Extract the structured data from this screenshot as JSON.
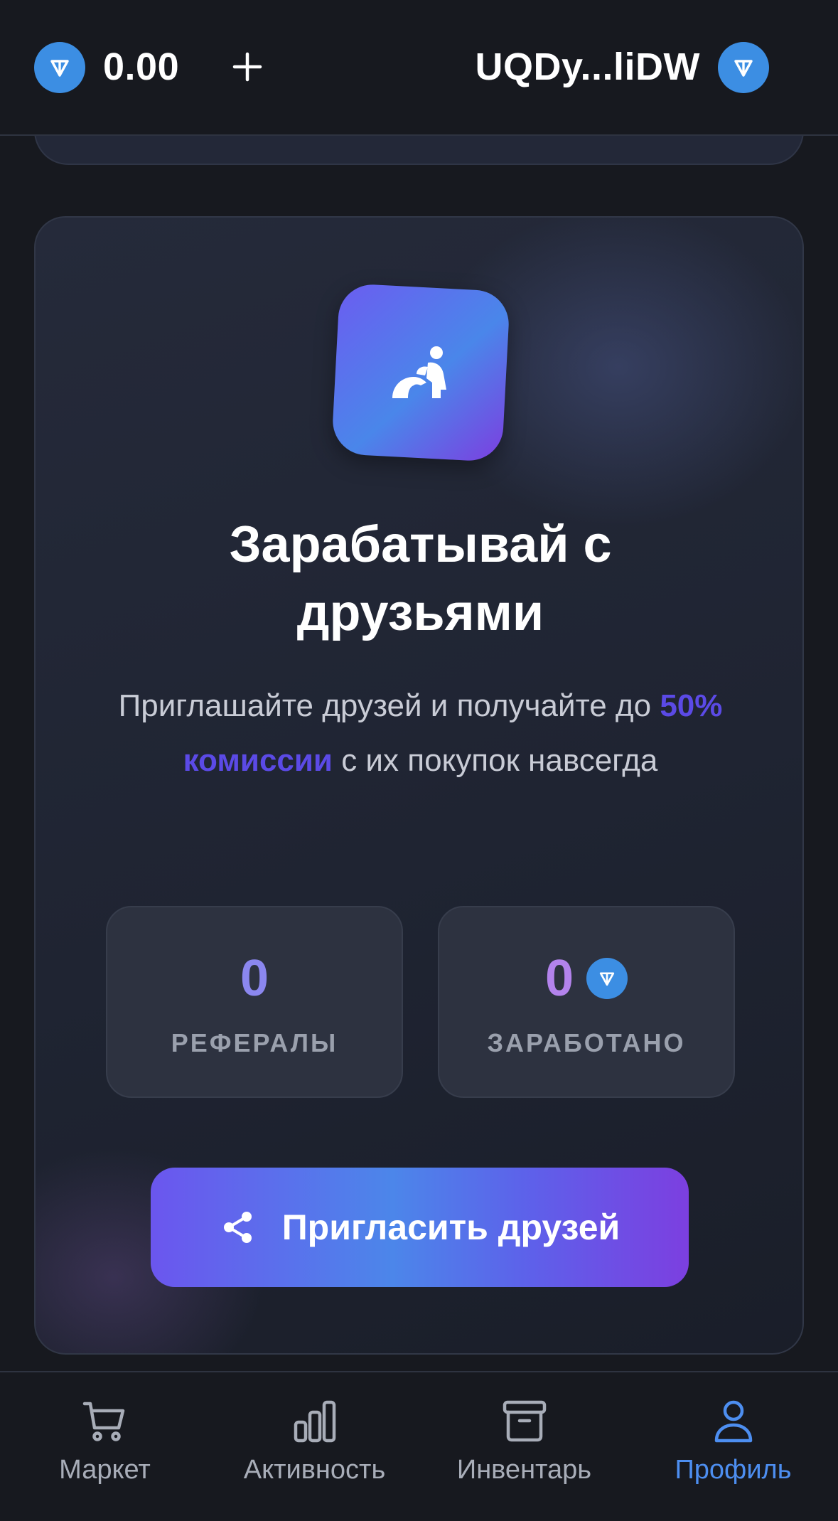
{
  "header": {
    "balance": "0.00",
    "wallet_address": "UQDy...liDW"
  },
  "referral_card": {
    "title": "Зарабатывай с друзьями",
    "subtitle_before": "Приглашайте друзей и получайте до ",
    "subtitle_highlight": "50% комиссии",
    "subtitle_after": " с их покупок навсегда",
    "stats": {
      "referrals_value": "0",
      "referrals_label": "РЕФЕРАЛЫ",
      "earned_value": "0",
      "earned_label": "ЗАРАБОТАНО"
    },
    "invite_button_label": "Пригласить друзей"
  },
  "nav": {
    "items": [
      {
        "label": "Маркет",
        "icon": "cart-icon",
        "active": false
      },
      {
        "label": "Активность",
        "icon": "bar-chart-icon",
        "active": false
      },
      {
        "label": "Инвентарь",
        "icon": "archive-box-icon",
        "active": false
      },
      {
        "label": "Профиль",
        "icon": "user-icon",
        "active": true
      }
    ]
  },
  "colors": {
    "background": "#17191f",
    "ton_blue": "#3c8ee3",
    "accent_purple": "#5b4ae6",
    "active_nav": "#4d8ef0"
  }
}
